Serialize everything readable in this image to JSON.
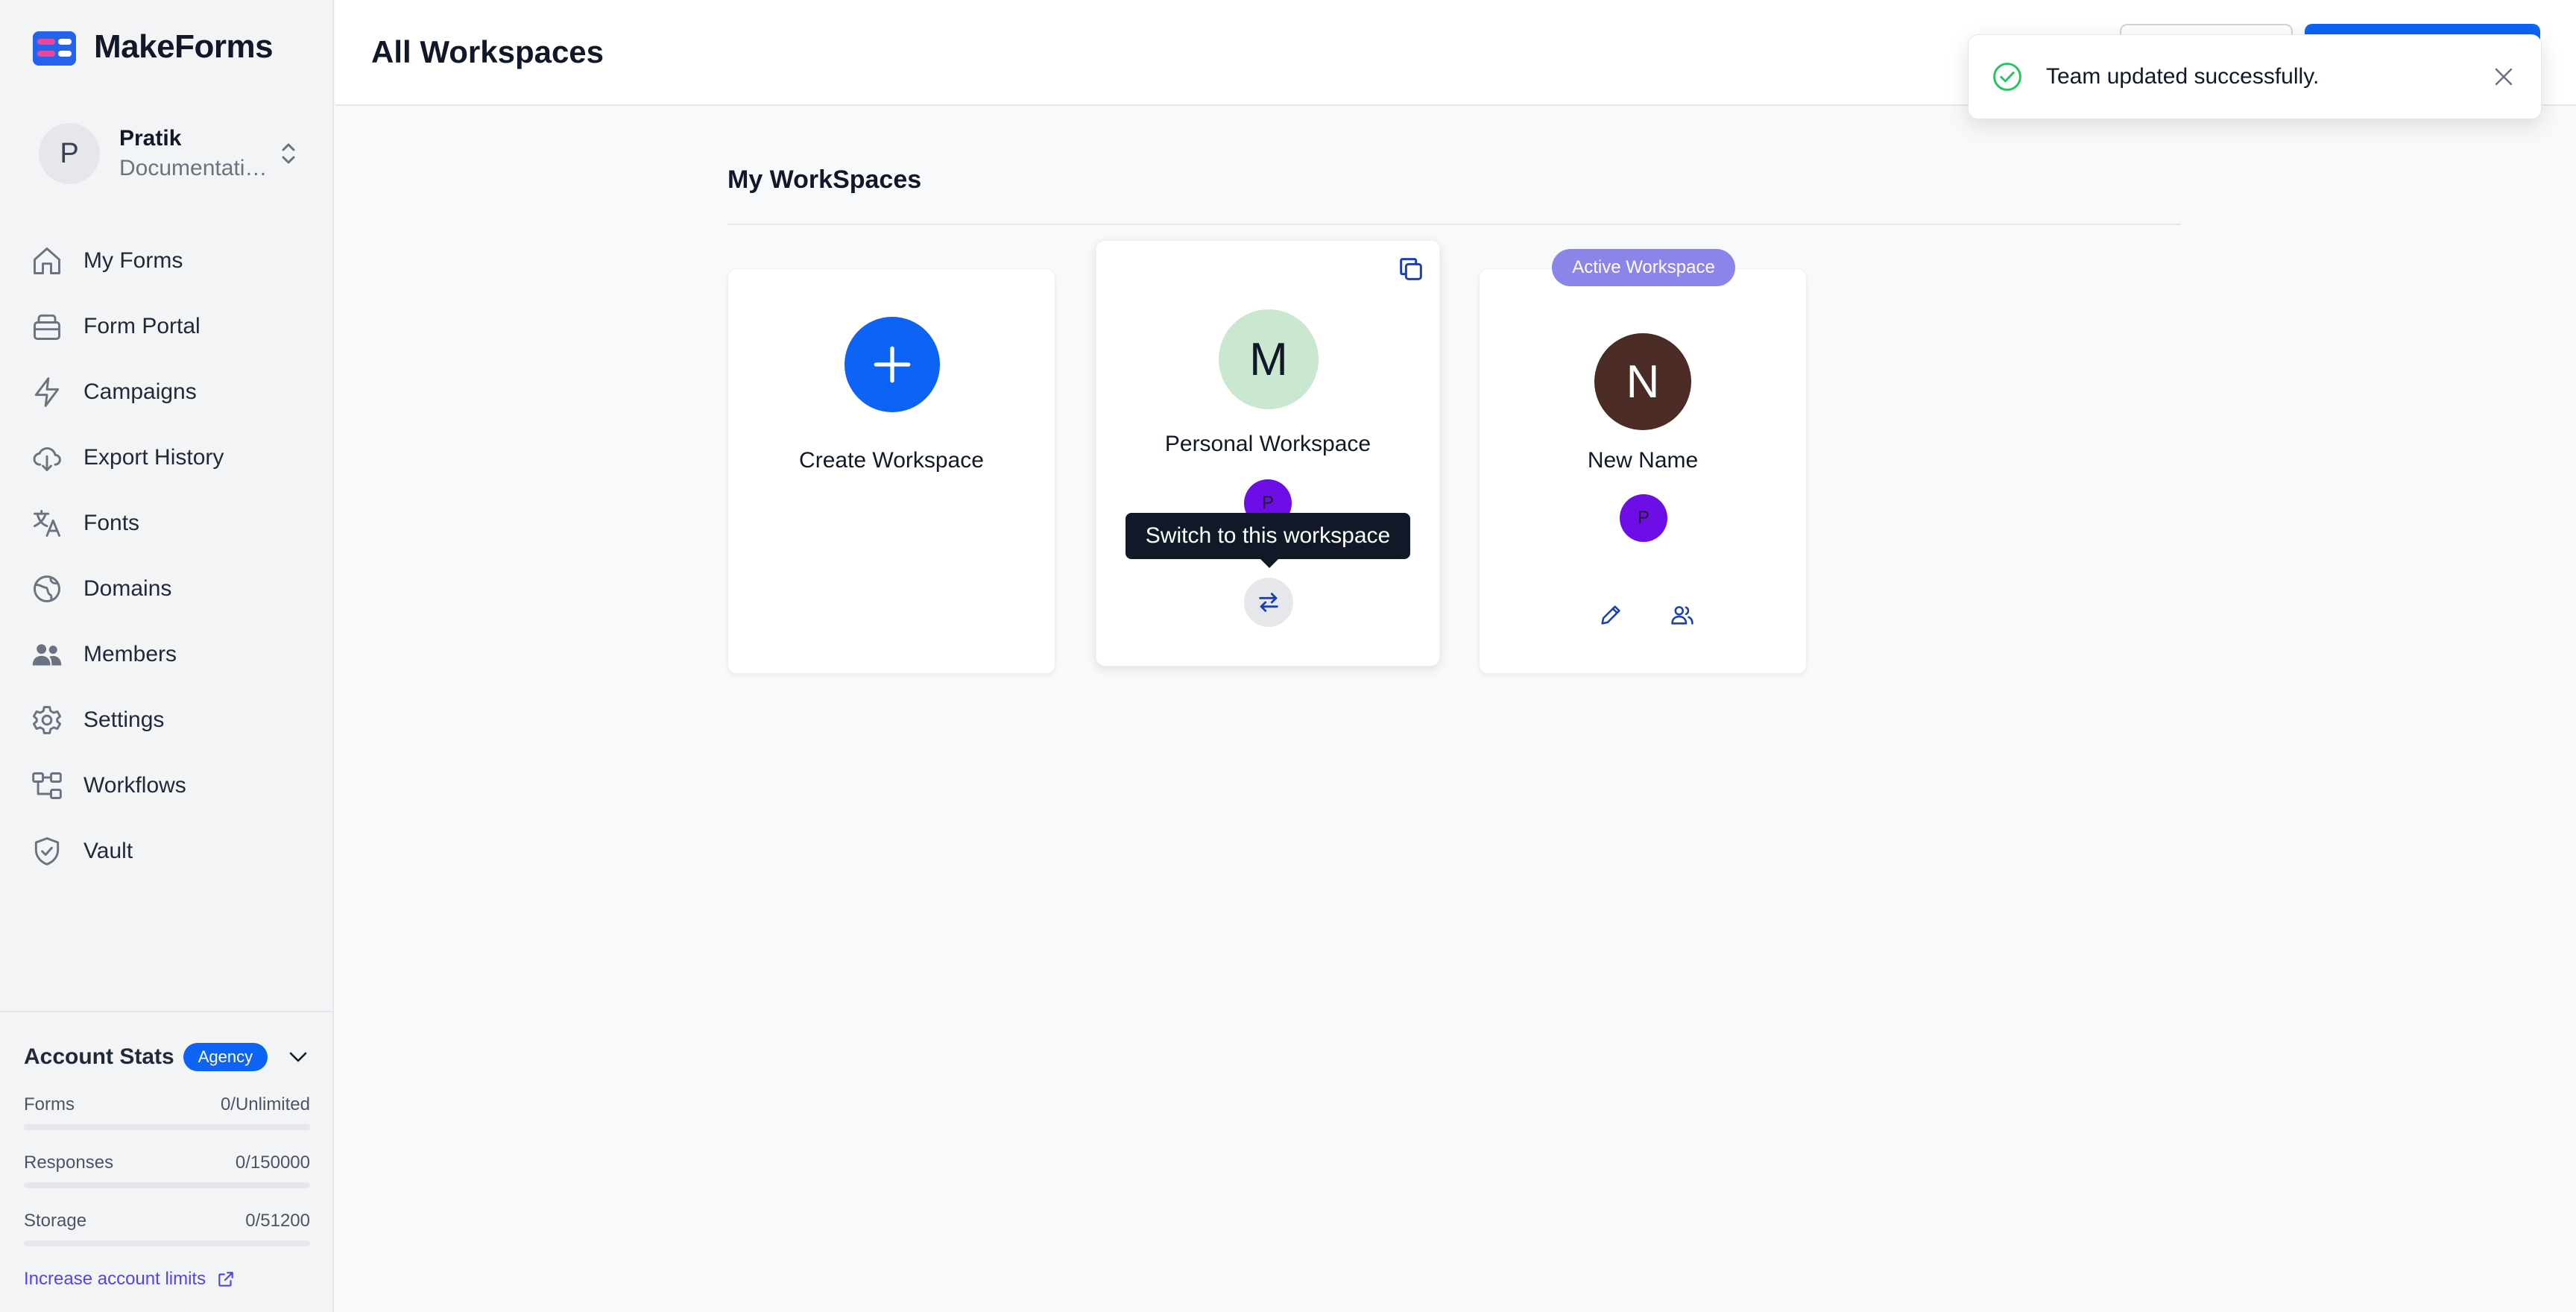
{
  "app": {
    "name": "MakeForms",
    "page_title": "All Workspaces"
  },
  "user": {
    "initial": "P",
    "name": "Pratik",
    "org": "Documentation"
  },
  "sidebar": {
    "items": [
      {
        "label": "My Forms",
        "icon": "home-icon"
      },
      {
        "label": "Form Portal",
        "icon": "portal-icon"
      },
      {
        "label": "Campaigns",
        "icon": "lightning-icon"
      },
      {
        "label": "Export History",
        "icon": "cloud-download-icon"
      },
      {
        "label": "Fonts",
        "icon": "translate-icon"
      },
      {
        "label": "Domains",
        "icon": "globe-icon"
      },
      {
        "label": "Members",
        "icon": "users-icon"
      },
      {
        "label": "Settings",
        "icon": "gear-icon"
      },
      {
        "label": "Workflows",
        "icon": "workflow-icon"
      },
      {
        "label": "Vault",
        "icon": "shield-icon"
      }
    ]
  },
  "stats": {
    "title": "Account Stats",
    "plan": "Agency",
    "rows": [
      {
        "label": "Forms",
        "value": "0/Unlimited",
        "fraction": 0
      },
      {
        "label": "Responses",
        "value": "0/150000",
        "fraction": 0
      },
      {
        "label": "Storage",
        "value": "0/51200",
        "fraction": 0
      }
    ],
    "increase_link": "Increase account limits"
  },
  "toast": {
    "message": "Team updated successfully."
  },
  "main": {
    "section_title": "My WorkSpaces",
    "create_label": "Create Workspace",
    "workspaces": [
      {
        "initial": "M",
        "name": "Personal Workspace",
        "member_initial": "P",
        "avatar_color": "#c9e8cf"
      },
      {
        "initial": "N",
        "name": "New Name",
        "member_initial": "P",
        "avatar_color": "#4a2c24",
        "active_label": "Active Workspace"
      }
    ],
    "tooltip": "Switch to this workspace"
  },
  "colors": {
    "primary": "#0d63f3",
    "active_pill": "#8b85ea",
    "success": "#22c55e"
  }
}
